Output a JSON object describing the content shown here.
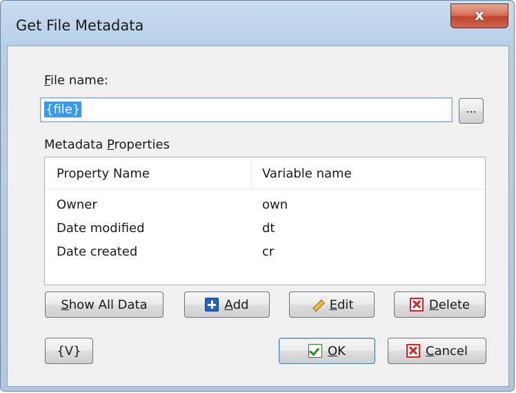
{
  "window": {
    "title": "Get File Metadata",
    "close_label": "x"
  },
  "file_name": {
    "label_accel": "F",
    "label_rest": "ile name:",
    "value": "{file}",
    "browse_label": "..."
  },
  "metadata": {
    "label_pre": "Metadata ",
    "label_accel": "P",
    "label_rest": "roperties",
    "columns": [
      "Property Name",
      "Variable name"
    ],
    "rows": [
      {
        "property": "Owner",
        "variable": "own"
      },
      {
        "property": "Date modified",
        "variable": "dt"
      },
      {
        "property": "Date created",
        "variable": "cr"
      }
    ]
  },
  "buttons": {
    "show_all_accel": "S",
    "show_all_rest": "how All Data",
    "add_accel": "A",
    "add_rest": "dd",
    "edit_accel": "E",
    "edit_rest": "dit",
    "delete_accel": "D",
    "delete_rest": "elete",
    "variables": "{V}",
    "ok_accel": "O",
    "ok_rest": "K",
    "cancel_accel": "C",
    "cancel_rest": "ancel"
  },
  "icons": {
    "add": "plus-icon",
    "edit": "pencil-icon",
    "delete": "x-icon",
    "ok": "check-icon",
    "cancel": "x-icon"
  }
}
